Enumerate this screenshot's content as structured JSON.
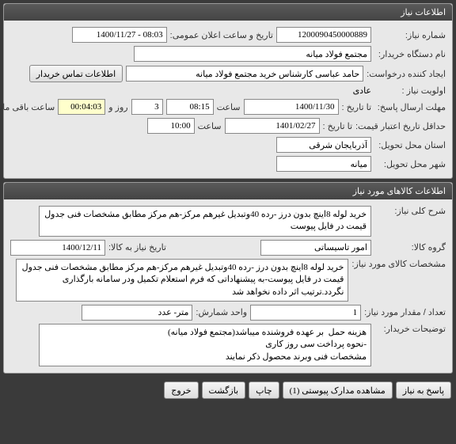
{
  "need_info_header": "اطلاعات نیاز",
  "fields": {
    "need_number_label": "شماره نیاز:",
    "need_number_value": "1200090450000889",
    "announce_label": "تاریخ و ساعت اعلان عمومی:",
    "announce_value": "08:03 - 1400/11/27",
    "buyer_org_label": "نام دستگاه خریدار:",
    "buyer_org_value": "مجتمع فولاد میانه",
    "requester_label": "ایجاد کننده درخواست:",
    "requester_value": "حامد عباسی کارشناس خرید مجتمع فولاد میانه",
    "contact_btn": "اطلاعات تماس خریدار",
    "priority_label": "اولویت نیاز :",
    "priority_value": "عادی",
    "deadline_label": "مهلت ارسال پاسخ:",
    "deadline_to": "تا تاریخ :",
    "deadline_date": "1400/11/30",
    "time_label": "ساعت",
    "deadline_time": "08:15",
    "days_value": "3",
    "days_and": "روز و",
    "timer_value": "00:04:03",
    "remain_label": "ساعت باقی مانده",
    "price_validity_label": "حداقل تاریخ اعتبار قیمت:",
    "price_validity_to": "تا تاریخ :",
    "price_validity_date": "1401/02/27",
    "price_validity_time": "10:00",
    "province_label": "استان محل تحویل:",
    "province_value": "آذربایجان شرقی",
    "city_label": "شهر محل تحویل:",
    "city_value": "میانه"
  },
  "goods_header": "اطلاعات کالاهای مورد نیاز",
  "goods": {
    "summary_label": "شرح کلی نیاز:",
    "summary_value": "خرید لوله 8اینچ بدون درز -رده 40وتبدیل غیرهم مرکز-هم مرکز مطابق مشخصات فنی جدول قیمت در فایل پیوست",
    "group_label": "گروه کالا:",
    "group_value": "امور تاسیساتی",
    "need_until_label": "تاریخ نیاز به کالا:",
    "need_until_value": "1400/12/11",
    "spec_label": "مشخصات کالای مورد نیاز:",
    "spec_value": "خرید لوله 8اینچ بدون درز -رده 40وتبدیل غیرهم مرکز-هم مرکز مطابق مشخصات فنی جدول قیمت در فایل پیوست-به پیشنهاداتی که فرم استعلام تکمیل ودر سامانه بارگذاری نگردد.ترتیب اثر داده نخواهد شد",
    "qty_label": "تعداد / مقدار مورد نیاز:",
    "qty_value": "1",
    "unit_label": "واحد شمارش:",
    "unit_value": "متر- عدد",
    "notes_label": "توضیحات خریدار:",
    "notes_value": "هزینه حمل  بر عهده فروشنده میباشد(مجتمع فولاد میانه)\n-نحوه پرداخت سی روز کاری\nمشخصات فنی وبرند محصول ذکر نمایند"
  },
  "buttons": {
    "reply": "پاسخ به نیاز",
    "attachments": "مشاهده مدارک پیوستی (1)",
    "print": "چاپ",
    "back": "بازگشت",
    "exit": "خروج"
  }
}
